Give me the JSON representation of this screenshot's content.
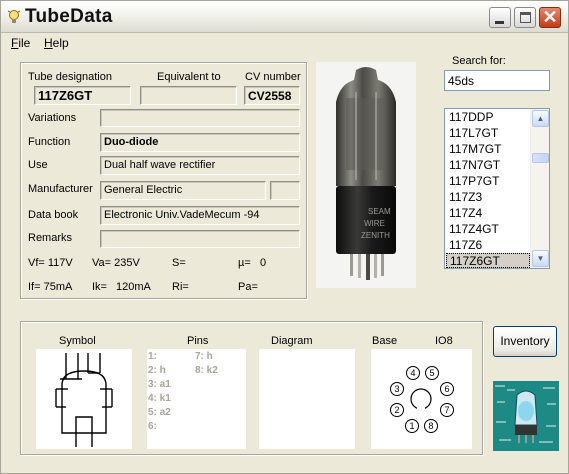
{
  "window": {
    "title": "TubeData",
    "app_icon": "lightbulb-icon",
    "close_glyph": "✕"
  },
  "menu": {
    "file": {
      "mnemonic": "F",
      "rest": "ile"
    },
    "help": {
      "mnemonic": "H",
      "rest": "elp"
    }
  },
  "details": {
    "tube_designation_label": "Tube designation",
    "tube_designation": "117Z6GT",
    "equivalent_label": "Equivalent to",
    "equivalent": "",
    "cv_label": "CV number",
    "cv": "CV2558",
    "variations_label": "Variations",
    "variations": "",
    "function_label": "Function",
    "function": "Duo-diode",
    "use_label": "Use",
    "use": "Dual half wave rectifier",
    "manufacturer_label": "Manufacturer",
    "manufacturer": "General Electric",
    "manufacturer_extra": "",
    "databook_label": "Data book",
    "databook": "Electronic Univ.VadeMecum -94",
    "remarks_label": "Remarks",
    "remarks": ""
  },
  "specs": {
    "vf": "Vf= 117V",
    "va": "Va= 235V",
    "s": "S=",
    "mu": "µ=",
    "mu_val": "0",
    "if": "If= 75mA",
    "ik": "Ik=",
    "ik_val": "120mA",
    "ri": "Ri=",
    "pa": "Pa="
  },
  "search": {
    "label": "Search for:",
    "value": "45ds"
  },
  "tube_list": {
    "items": [
      "117DDP",
      "117L7GT",
      "117M7GT",
      "117N7GT",
      "117P7GT",
      "117Z3",
      "117Z4",
      "117Z4GT",
      "117Z6",
      "117Z6GT"
    ],
    "selected_index": 9,
    "scroll_up": "▲",
    "scroll_down": "▼"
  },
  "bottom": {
    "symbol_label": "Symbol",
    "pins_label": "Pins",
    "diagram_label": "Diagram",
    "base_label": "Base",
    "base_type": "IO8",
    "pins_left": [
      "1:",
      "2: h",
      "3: a1",
      "4: k1",
      "5: a2",
      "6:"
    ],
    "pins_right": [
      "7: h",
      "8: k2"
    ],
    "base_pins": [
      "1",
      "2",
      "3",
      "4",
      "5",
      "6",
      "7",
      "8"
    ]
  },
  "buttons": {
    "inventory": "Inventory"
  },
  "photo_text": [
    "SEAM",
    "WIRE",
    "ZENITH"
  ],
  "colors": {
    "close_red": "#c33a17",
    "selected_row": "#d4d0c8",
    "logo_teal": "#1d8a86"
  }
}
